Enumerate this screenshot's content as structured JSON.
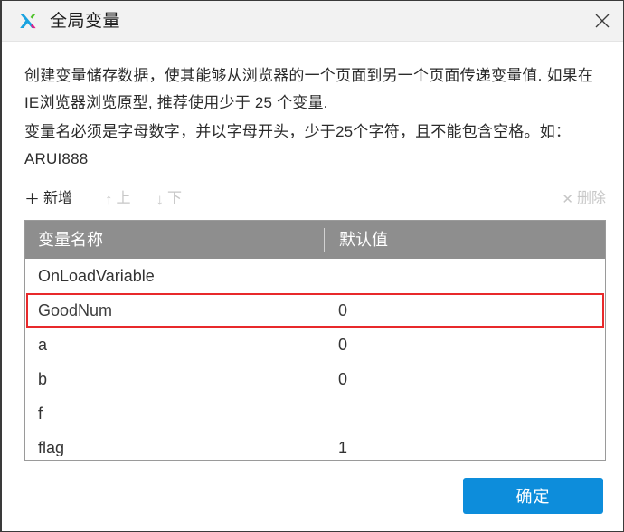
{
  "window": {
    "title": "全局变量",
    "logo_icon": "xmind-x-logo-icon",
    "close_icon": "close-icon"
  },
  "description": {
    "paragraph_1": "创建变量储存数据，使其能够从浏览器的一个页面到另一个页面传递变量值. 如果在IE浏览器浏览原型, 推荐使用少于 25 个变量.",
    "paragraph_2": "变量名必须是字母数字，并以字母开头，少于25个字符，且不能包含空格。如：ARUI888"
  },
  "toolbar": {
    "add": {
      "label": "新增",
      "glyph": "＋",
      "icon": "plus-icon",
      "enabled": true
    },
    "move_up": {
      "label": "上",
      "glyph": "↑",
      "icon": "arrow-up-icon",
      "enabled": false
    },
    "move_down": {
      "label": "下",
      "glyph": "↓",
      "icon": "arrow-down-icon",
      "enabled": false
    },
    "delete": {
      "label": "删除",
      "glyph": "✕",
      "icon": "close-x-icon",
      "enabled": false
    }
  },
  "table": {
    "columns": [
      "变量名称",
      "默认值"
    ],
    "rows": [
      {
        "name": "OnLoadVariable",
        "value": "",
        "selected": false
      },
      {
        "name": "GoodNum",
        "value": "0",
        "selected": true
      },
      {
        "name": "a",
        "value": "0",
        "selected": false
      },
      {
        "name": "b",
        "value": "0",
        "selected": false
      },
      {
        "name": "f",
        "value": "",
        "selected": false
      },
      {
        "name": "flag",
        "value": "1",
        "selected": false
      }
    ]
  },
  "footer": {
    "confirm_label": "确定"
  },
  "colors": {
    "accent_blue": "#0d8ddb",
    "selection_red": "#e8292b",
    "header_gray": "#8e8e8e",
    "titlebar_gray": "#f2f2f2",
    "disabled_gray": "#c7c7c7"
  }
}
